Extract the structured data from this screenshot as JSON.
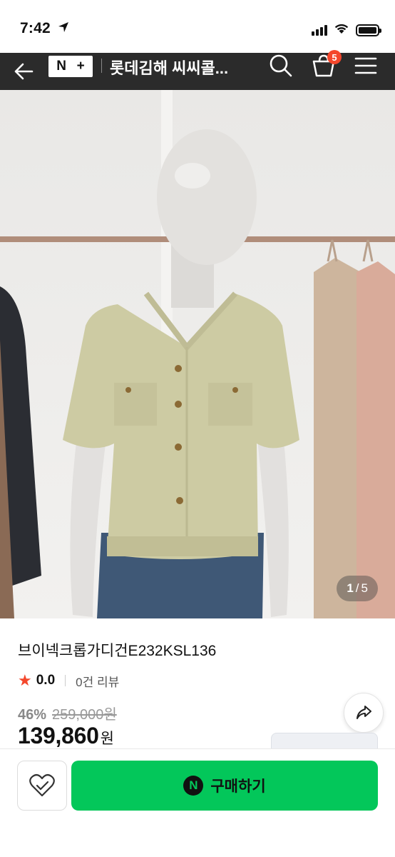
{
  "status": {
    "time": "7:42"
  },
  "header": {
    "logo_text_n": "N",
    "logo_text_plus": "+",
    "store_title": "롯데김해 씨씨콜...",
    "cart_count": "5"
  },
  "gallery": {
    "current": "1",
    "total": "5"
  },
  "product": {
    "name": "브이넥크롭가디건E232KSL136",
    "rating": "0.0",
    "review_count": "0건 리뷰",
    "discount": "46%",
    "original_price": "259,000원",
    "sale_price": "139,860",
    "currency": "원"
  },
  "actions": {
    "buy_label": "구매하기",
    "npay_symbol": "N"
  },
  "colors": {
    "accent_green": "#03c75a",
    "badge_red": "#f4472c",
    "header_bg": "#2b2b2b"
  }
}
